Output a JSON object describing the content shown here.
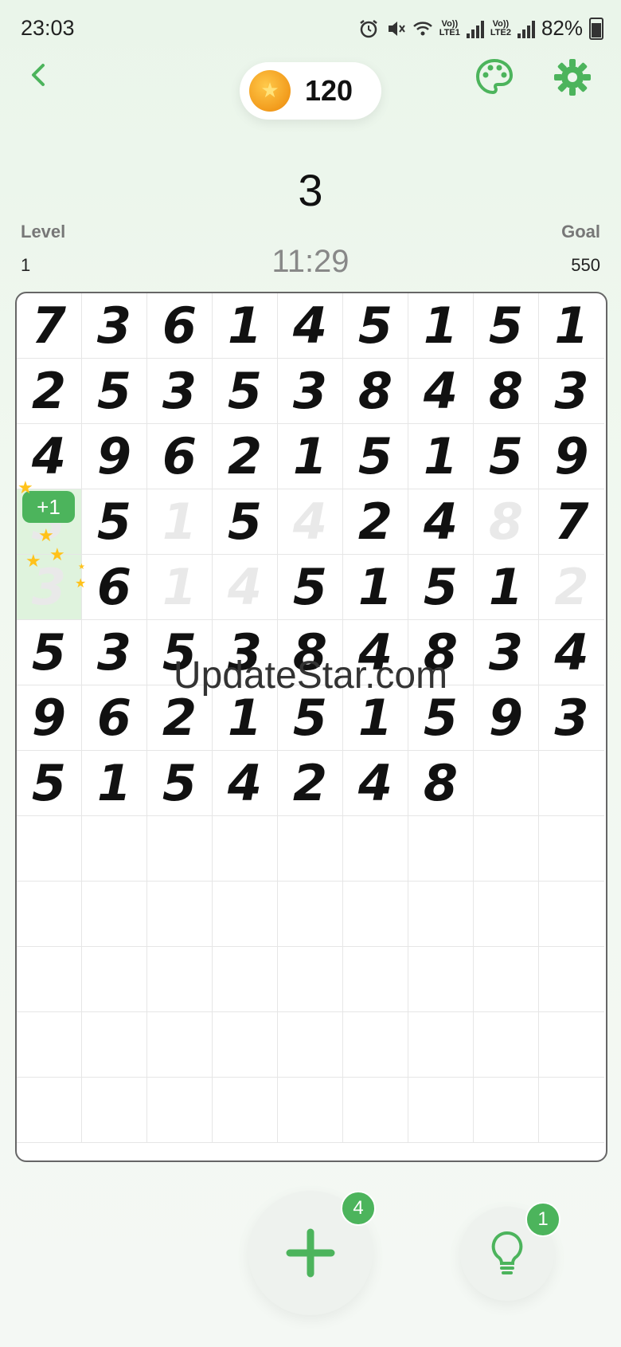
{
  "status_bar": {
    "time": "23:03",
    "battery": "82%"
  },
  "header": {
    "coins": "120"
  },
  "target_number": "3",
  "level": {
    "label": "Level",
    "value": "1"
  },
  "goal": {
    "label": "Goal",
    "value": "550"
  },
  "timer": "11:29",
  "board": {
    "rows": [
      [
        "7",
        "3",
        "6",
        "1",
        "4",
        "5",
        "1",
        "5",
        "1"
      ],
      [
        "2",
        "5",
        "3",
        "5",
        "3",
        "8",
        "4",
        "8",
        "3"
      ],
      [
        "4",
        "9",
        "6",
        "2",
        "1",
        "5",
        "1",
        "5",
        "9"
      ],
      [
        "3",
        "5",
        "1",
        "5",
        "4",
        "2",
        "4",
        "8",
        "7"
      ],
      [
        "3",
        "6",
        "1",
        "4",
        "5",
        "1",
        "5",
        "1",
        "2"
      ],
      [
        "5",
        "3",
        "5",
        "3",
        "8",
        "4",
        "8",
        "3",
        "4"
      ],
      [
        "9",
        "6",
        "2",
        "1",
        "5",
        "1",
        "5",
        "9",
        "3"
      ],
      [
        "5",
        "1",
        "5",
        "4",
        "2",
        "4",
        "8",
        "",
        ""
      ],
      [
        "",
        "",
        "",
        "",
        "",
        "",
        "",
        "",
        ""
      ],
      [
        "",
        "",
        "",
        "",
        "",
        "",
        "",
        "",
        ""
      ],
      [
        "",
        "",
        "",
        "",
        "",
        "",
        "",
        "",
        ""
      ],
      [
        "",
        "",
        "",
        "",
        "",
        "",
        "",
        "",
        ""
      ],
      [
        "",
        "",
        "",
        "",
        "",
        "",
        "",
        "",
        ""
      ]
    ],
    "cleared": [
      [
        3,
        2
      ],
      [
        3,
        4
      ],
      [
        3,
        7
      ],
      [
        4,
        2
      ],
      [
        4,
        3
      ],
      [
        4,
        8
      ],
      [
        3,
        0
      ],
      [
        4,
        0
      ]
    ],
    "highlighted": [
      [
        3,
        0
      ],
      [
        4,
        0
      ]
    ]
  },
  "score_popup": "+1",
  "watermark": "UpdateStar.com",
  "add_button": {
    "badge": "4"
  },
  "hint_button": {
    "badge": "1"
  },
  "colors": {
    "accent": "#4cb45c",
    "coin": "#f29b1c"
  }
}
